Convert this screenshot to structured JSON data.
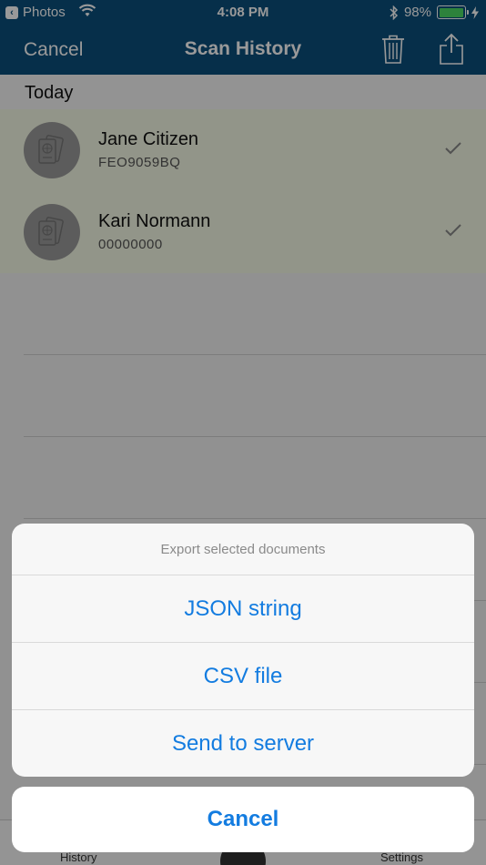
{
  "status_bar": {
    "back_app": "Photos",
    "time": "4:08 PM",
    "battery": "98%",
    "battery_level": 0.98
  },
  "nav": {
    "cancel": "Cancel",
    "title": "Scan History",
    "trash_icon": "trash-icon",
    "share_icon": "share-icon"
  },
  "list": {
    "section": "Today",
    "items": [
      {
        "name": "Jane Citizen",
        "doc": "FEO9059BQ",
        "icon": "passport-icon",
        "selected": true
      },
      {
        "name": "Kari Normann",
        "doc": "00000000",
        "icon": "passport-icon",
        "selected": true
      }
    ]
  },
  "tabs": {
    "history": "History",
    "settings": "Settings"
  },
  "sheet": {
    "title": "Export selected documents",
    "options": [
      "JSON string",
      "CSV file",
      "Send to server"
    ],
    "cancel": "Cancel"
  },
  "colors": {
    "nav_bg": "#0b4f7c",
    "accent": "#137ce0",
    "selected_row": "#f3f8e4"
  }
}
